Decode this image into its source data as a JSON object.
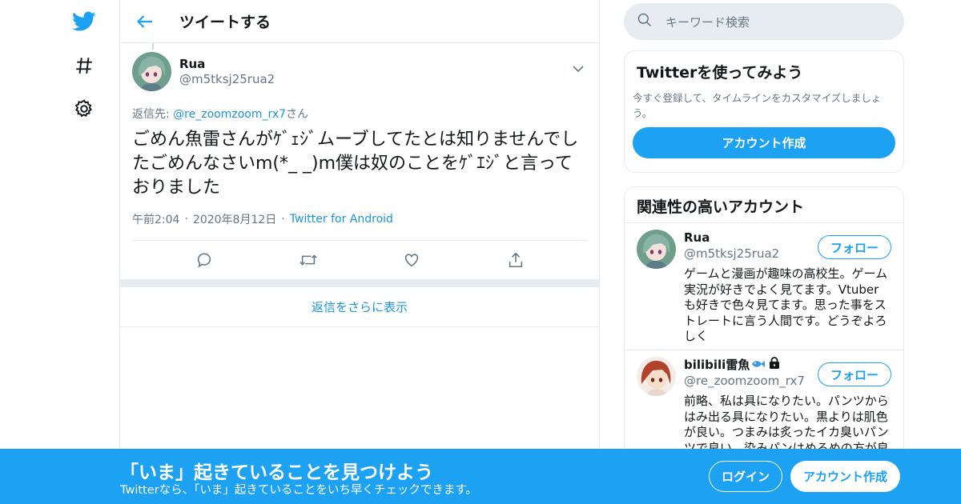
{
  "colors": {
    "accent": "#1da1f2",
    "link": "#1b95e0",
    "muted": "#657786",
    "border": "#e6ecf0"
  },
  "nav": {
    "icons": [
      "twitter-bird-icon",
      "hashtag-icon",
      "gear-icon"
    ]
  },
  "header": {
    "title": "ツイートする"
  },
  "tweet": {
    "user_name": "Rua",
    "user_handle": "@m5tksj25rua2",
    "reply_prefix": "返信先: ",
    "reply_mention": "@re_zoomzoom_rx7",
    "reply_suffix": "さん",
    "text": "ごめん魚雷さんがｹﾞｪｼﾞムーブしてたとは知りませんでしたごめんなさいm(*_ _)m僕は奴のことをｹﾞｴｼﾞと言っておりました",
    "time": "午前2:04",
    "date": "2020年8月12日",
    "source": "Twitter for Android",
    "separator": "·",
    "actions": [
      "reply-icon",
      "retweet-icon",
      "like-icon",
      "share-icon"
    ]
  },
  "more_replies": "返信をさらに表示",
  "search": {
    "placeholder": "キーワード検索"
  },
  "signup_card": {
    "title": "Twitterを使ってみよう",
    "desc": "今すぐ登録して、タイムラインをカスタマイズしましょう。",
    "button": "アカウント作成"
  },
  "related": {
    "title": "関連性の高いアカウント",
    "follow_label": "フォロー",
    "users": [
      {
        "name": "Rua",
        "handle": "@m5tksj25rua2",
        "bio": "ゲームと漫画が趣味の高校生。ゲーム実況が好きでよく見てます。Vtuberも好きで色々見てます。思った事をストレートに言う人間です。どうぞよろしく"
      },
      {
        "name": "bilibili雷魚",
        "handle": "@re_zoomzoom_rx7",
        "bio": "前略、私は具になりたい。パンツからはみ出る具になりたい。黒よりは肌色が良い。つまみは炙ったイカ臭いパンツで良い。染みパンはめるめの方が良"
      }
    ]
  },
  "banner": {
    "title": "「いま」起きていることを見つけよう",
    "subtitle": "Twitterなら、「いま」起きていることをいち早くチェックできます。",
    "login": "ログイン",
    "signup": "アカウント作成"
  }
}
